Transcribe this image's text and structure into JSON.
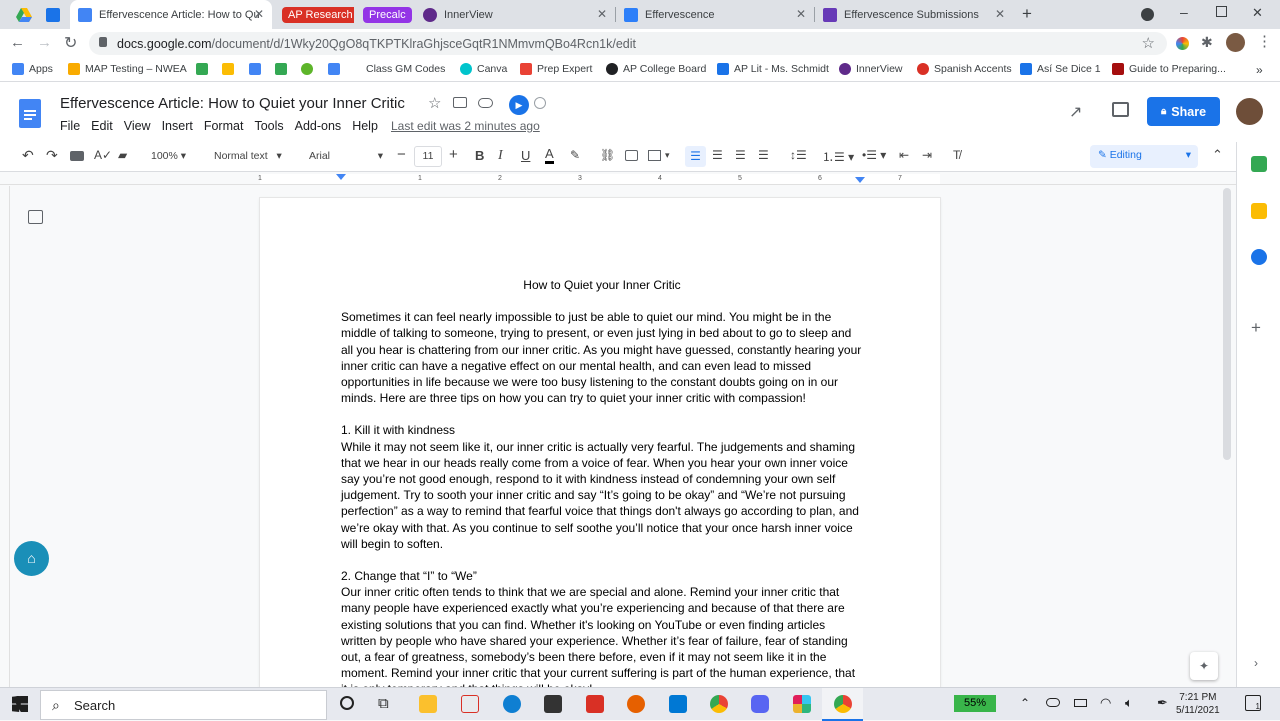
{
  "browser": {
    "tabs": [
      {
        "label": "",
        "kind": "icon"
      },
      {
        "label": "",
        "kind": "icon"
      },
      {
        "label": "Effervescence Article: How to Qu",
        "active": true
      },
      {
        "label": "AP Research",
        "pill": "#d93025"
      },
      {
        "label": "Precalc",
        "pill": "#9334e6"
      },
      {
        "label": "InnerView"
      },
      {
        "label": "Effervescence"
      },
      {
        "label": "Effervescence Submissions"
      }
    ],
    "url_host": "docs.google.com",
    "url_path": "/document/d/1Wky20QgO8qTKPTKlraGhjsceGqtR1NMmvmQBo4Rcn1k/edit",
    "bookmarks": [
      {
        "label": "Apps",
        "color": "#4285f4"
      },
      {
        "label": "MAP Testing – NWEA",
        "color": "#f9ab00"
      },
      {
        "label": "",
        "color": "#34a853"
      },
      {
        "label": "",
        "color": "#fbbc04"
      },
      {
        "label": "",
        "color": "#4285f4"
      },
      {
        "label": "",
        "color": "#34a853"
      },
      {
        "label": "",
        "color": "#5db52a"
      },
      {
        "label": "Class GM Codes",
        "color": "#4285f4"
      },
      {
        "label": "Canva",
        "color": "#00c4cc"
      },
      {
        "label": "Prep Expert",
        "color": "#e94235"
      },
      {
        "label": "AP College Board",
        "color": "#202124"
      },
      {
        "label": "AP Lit - Ms. Schmidt",
        "color": "#1a73e8"
      },
      {
        "label": "InnerView",
        "color": "#5f2a8a"
      },
      {
        "label": "Spanish Accents",
        "color": "#d93025"
      },
      {
        "label": "Así Se Dice 1",
        "color": "#1a73e8"
      },
      {
        "label": "Guide to Preparing...",
        "color": "#a50e0e"
      }
    ]
  },
  "docs": {
    "title": "Effervescence Article: How to Quiet your Inner Critic",
    "menus": [
      "File",
      "Edit",
      "View",
      "Insert",
      "Format",
      "Tools",
      "Add-ons",
      "Help"
    ],
    "last_edit": "Last edit was 2 minutes ago",
    "share_label": "Share",
    "toolbar": {
      "zoom": "100%",
      "style": "Normal text",
      "font": "Arial",
      "font_size": "11",
      "mode": "Editing"
    },
    "ruler_ticks": [
      "1",
      "1",
      "2",
      "3",
      "4",
      "5",
      "6",
      "7"
    ]
  },
  "document": {
    "heading": "How to Quiet your Inner Critic",
    "intro": "Sometimes it can feel nearly impossible to just be able to quiet our mind. You might be in the middle of talking to someone, trying to present, or even just lying in bed about to go to sleep and all you hear is chattering from our inner critic. As you might have guessed, constantly hearing your inner critic can have a negative effect on our mental health, and can even lead to missed opportunities in life because we were too busy listening to the constant doubts going on in our minds. Here are three tips on how you can try to quiet your inner critic with compassion!",
    "tip1_title": "1. Kill it with kindness",
    "tip1_body": "While it may not seem like it, our inner critic is actually very fearful. The judgements and shaming that we hear in our heads really come from a voice of fear. When you hear your own inner voice say you’re not good enough, respond to it with kindness instead of condemning your own self judgement. Try to sooth your inner critic and say “It’s going to be okay” and “We’re not pursuing perfection” as a way to remind that fearful voice that things don't always go according to plan, and we’re okay with that. As you continue to self soothe you’ll notice that your once harsh inner voice will begin to soften.",
    "tip2_title": "2. Change that “I” to “We”",
    "tip2_body": "Our inner critic often tends to think that we are special and alone. Remind your inner critic that many people have experienced exactly what you’re experiencing and because of that there are existing solutions that you can find. Whether it's looking on YouTube or even finding articles written by people who have shared your experience. Whether it’s fear of failure, fear of standing out, a fear of greatness, somebody’s been there before, even if it may not seem like it in the moment. Remind your inner critic that your current suffering is part of the human experience, that it is only temporary and that things will be okay!"
  },
  "taskbar": {
    "search_placeholder": "Search",
    "battery": "55%",
    "time": "7:21 PM",
    "date": "5/11/2021",
    "notification_count": "1"
  }
}
